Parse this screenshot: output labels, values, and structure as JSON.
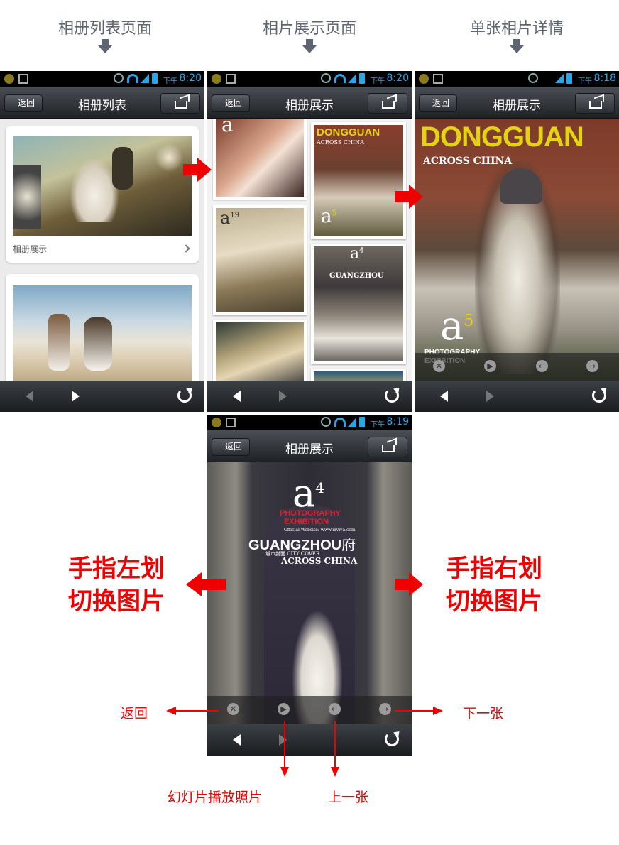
{
  "headers": [
    "相册列表页面",
    "相片展示页面",
    "单张相片详情"
  ],
  "phones": [
    {
      "time": "8:20",
      "ampm": "下午",
      "back": "返回",
      "title": "相册列表"
    },
    {
      "time": "8:20",
      "ampm": "下午",
      "back": "返回",
      "title": "相册展示"
    },
    {
      "time": "8:18",
      "ampm": "下午",
      "back": "返回",
      "title": "相册展示"
    },
    {
      "time": "8:19",
      "ampm": "下午",
      "back": "返回",
      "title": "相册展示"
    }
  ],
  "album_list": {
    "caption": "相册展示"
  },
  "magazine": {
    "dongguan": "DONGGUAN",
    "across_china": "ACROSS CHINA",
    "a5": "a",
    "a5_sup": "5",
    "a4": "a",
    "a4_sup": "4",
    "a19": "a",
    "a19_sup": "19",
    "photography": "PHOTOGRAPHY",
    "exhibition": "EXHIBITION",
    "guangzhou": "GUANGZHOU",
    "guangzhou_char": "府",
    "city_cover": "城市封面 CITY COVER",
    "website": "Official Website: www.iaviva.com"
  },
  "annotations": {
    "swipe_left": [
      "手指左划",
      "切换图片"
    ],
    "swipe_right": [
      "手指右划",
      "切换图片"
    ],
    "back": "返回",
    "next": "下一张",
    "slideshow": "幻灯片播放照片",
    "prev": "上一张"
  },
  "colors": {
    "accent": "#e00000",
    "header_text": "#5d6670",
    "status_blue": "#2aa6e6"
  }
}
